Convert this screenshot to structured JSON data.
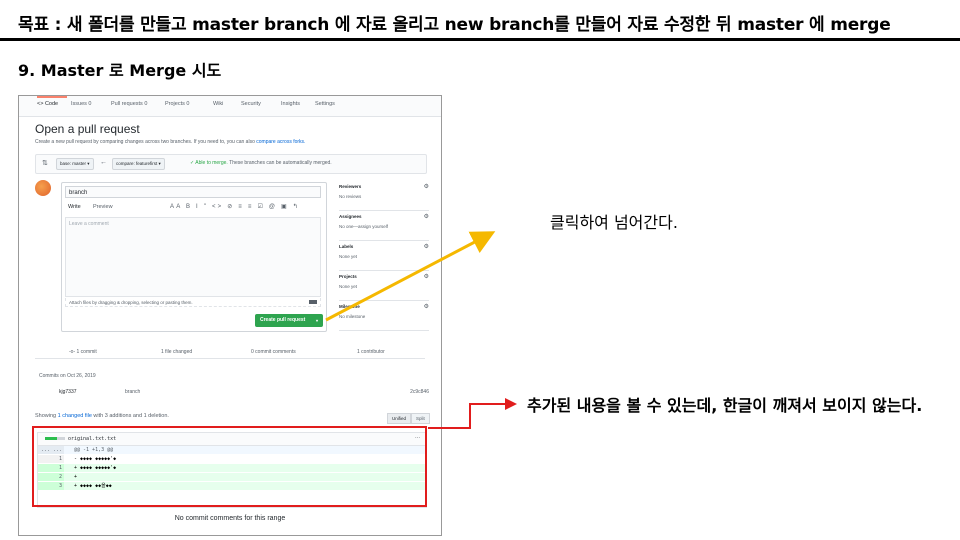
{
  "slide": {
    "title": "목표 : 새 폴더를 만들고 master branch 에 자료 올리고 new branch를 만들어 자료 수정한 뒤 master 에 merge",
    "subtitle": "9. Master 로 Merge 시도"
  },
  "annotations": {
    "click_note": "클릭하여 넘어간다.",
    "added_note": "추가된 내용을 볼 수 있는데, 한글이 깨져서 보이지 않는다."
  },
  "colors": {
    "highlight_box": "#e11d1d",
    "arrow_yellow": "#f5b800",
    "arrow_red": "#e11d1d",
    "create_button": "#2ea44f"
  },
  "repo_tabs": [
    {
      "icon": "code-icon",
      "label": "<> Code"
    },
    {
      "icon": "issue-icon",
      "label": "Issues 0"
    },
    {
      "icon": "pull-request-icon",
      "label": "Pull requests 0"
    },
    {
      "icon": "project-icon",
      "label": "Projects 0"
    },
    {
      "icon": "book-icon",
      "label": "Wiki"
    },
    {
      "icon": "shield-icon",
      "label": "Security"
    },
    {
      "icon": "graph-icon",
      "label": "Insights"
    },
    {
      "icon": "gear-icon",
      "label": "Settings"
    }
  ],
  "pr": {
    "heading": "Open a pull request",
    "desc": "Create a new pull request by comparing changes across two branches. If you need to, you can also",
    "desc_link": "compare across forks.",
    "base": "base: master ▾",
    "compare": "compare: featurefirst ▾",
    "able": "✓ Able to merge.",
    "able_rest": "These branches can be automatically merged.",
    "title_value": "branch",
    "write_tab": "Write",
    "preview_tab": "Preview",
    "toolbar": "AA B I  \" <> ⊘  ≡ ≡ ☑  @ ▣ ↰",
    "comment_placeholder": "Leave a comment",
    "attach": "Attach files by dragging & dropping, selecting or pasting them.",
    "create_button": "Create pull request",
    "create_caret": "▾"
  },
  "sidebar": [
    {
      "head": "Reviewers",
      "value": "No reviews"
    },
    {
      "head": "Assignees",
      "value": "No one—assign yourself"
    },
    {
      "head": "Labels",
      "value": "None yet"
    },
    {
      "head": "Projects",
      "value": "None yet"
    },
    {
      "head": "Milestone",
      "value": "No milestone"
    }
  ],
  "stats": {
    "commits": "-o- 1 commit",
    "files": "1 file changed",
    "comments": "0 commit comments",
    "contributors": "1 contributor"
  },
  "commits": {
    "date_label": "Commits on Oct 26, 2019",
    "author": "kjg7337",
    "message": "branch",
    "sha": "2c9c846"
  },
  "diff_summary": {
    "prefix": "Showing",
    "link": "1 changed file",
    "rest": "with 3 additions and 1 deletion.",
    "unified": "Unified",
    "split": "Split"
  },
  "diff": {
    "filename": "original.txt.txt",
    "more": "···",
    "lines": [
      {
        "type": "hunk",
        "num": "... ...",
        "code": "@@ -1 +1,3 @@"
      },
      {
        "type": "del",
        "num": "1",
        "code": "- ◆◆◆◆ ◆◆◆◆◆'◆"
      },
      {
        "type": "add",
        "num": "1",
        "code": "+ ◆◆◆◆ ◆◆◆◆◆'◆"
      },
      {
        "type": "add",
        "num": "2",
        "code": "+"
      },
      {
        "type": "add",
        "num": "3",
        "code": "+ ◆◆◆◆ ◆◆을◆◆"
      }
    ]
  },
  "footer": "No commit comments for this range"
}
